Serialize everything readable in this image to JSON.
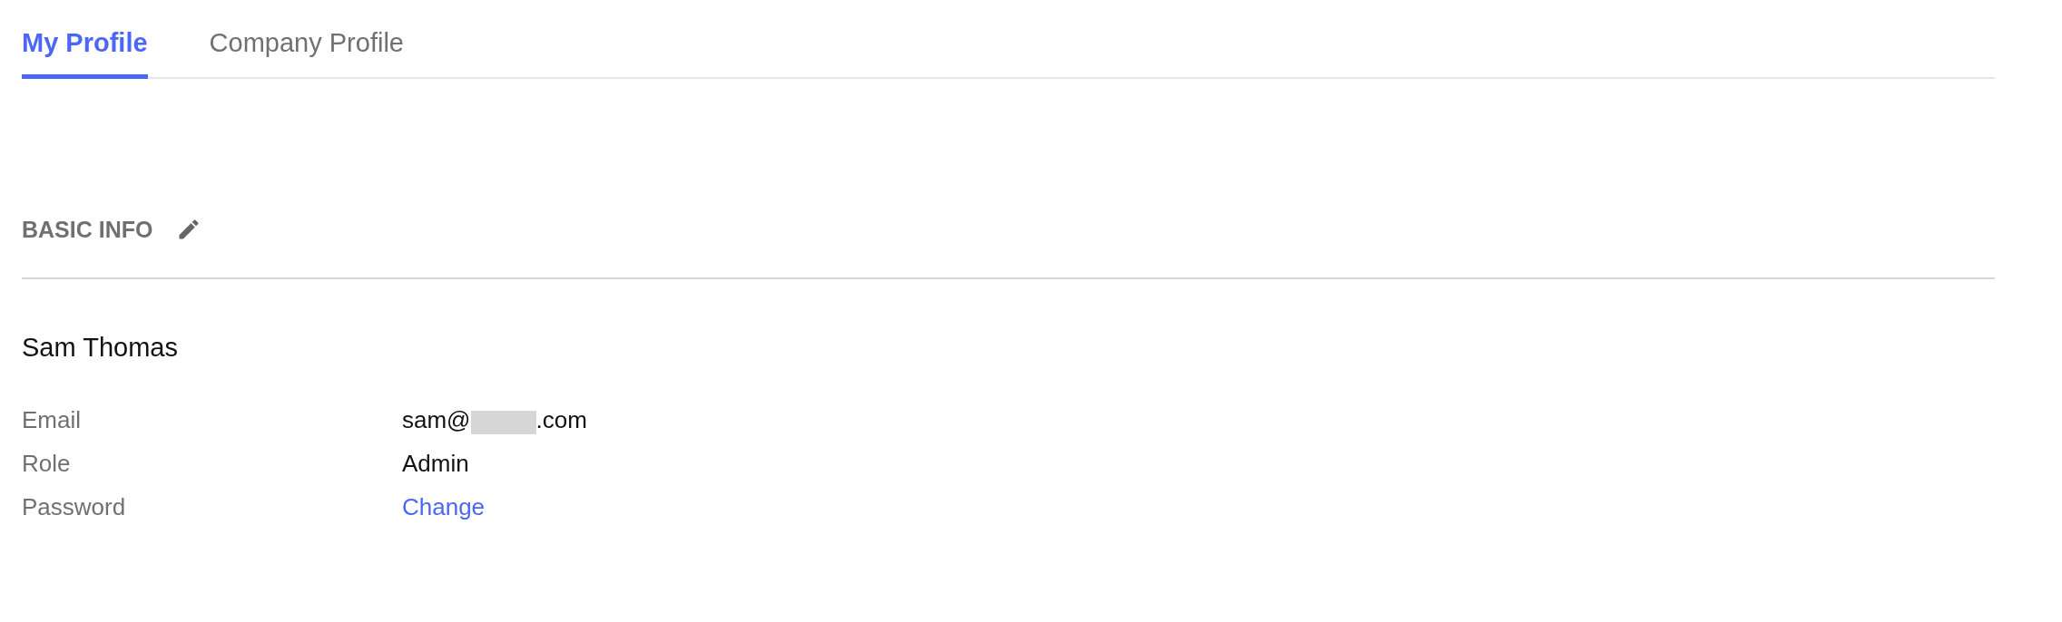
{
  "tabs": [
    {
      "label": "My Profile",
      "selected": true
    },
    {
      "label": "Company Profile",
      "selected": false
    }
  ],
  "section": {
    "title": "BASIC INFO"
  },
  "name": "Sam Thomas",
  "fields": [
    {
      "kind": "redacted",
      "label": "Email",
      "value_start": "sam@",
      "value_end": ".com"
    },
    {
      "kind": "text",
      "label": "Role",
      "value": "Admin"
    },
    {
      "kind": "link",
      "label": "Password",
      "value": "Change"
    }
  ]
}
